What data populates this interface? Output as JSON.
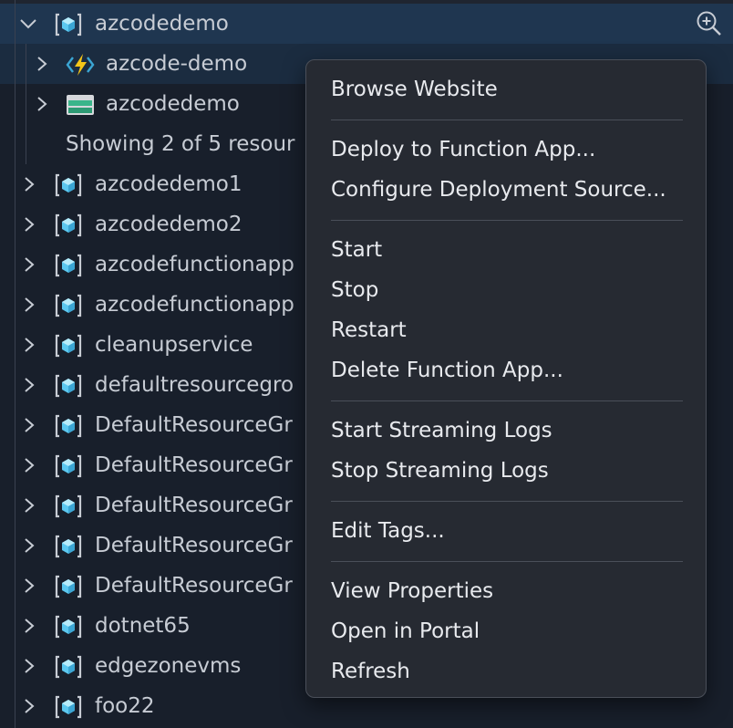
{
  "tree": {
    "root": {
      "label": "azcodedemo"
    },
    "children": [
      {
        "label": "azcode-demo",
        "icon": "function-app-icon"
      },
      {
        "label": "azcodedemo",
        "icon": "storage-account-icon"
      }
    ],
    "showing_text": "Showing 2 of 5 resour",
    "groups": [
      "azcodedemo1",
      "azcodedemo2",
      "azcodefunctionapp",
      "azcodefunctionapp",
      "cleanupservice",
      "defaultresourcegro",
      "DefaultResourceGr",
      "DefaultResourceGr",
      "DefaultResourceGr",
      "DefaultResourceGr",
      "DefaultResourceGr",
      "dotnet65",
      "edgezonevms",
      "foo22"
    ]
  },
  "context_menu": {
    "sections": [
      [
        "Browse Website"
      ],
      [
        "Deploy to Function App...",
        "Configure Deployment Source..."
      ],
      [
        "Start",
        "Stop",
        "Restart",
        "Delete Function App..."
      ],
      [
        "Start Streaming Logs",
        "Stop Streaming Logs"
      ],
      [
        "Edit Tags..."
      ],
      [
        "View Properties",
        "Open in Portal",
        "Refresh"
      ]
    ]
  },
  "colors": {
    "background": "#181f2b",
    "selected_row": "#1f3650",
    "menu_background": "#262a32",
    "text": "#c7ccd4",
    "menu_text": "#e8eaee",
    "resource_group_icon": "#7fd3f0",
    "function_icon": "#f5c518"
  }
}
